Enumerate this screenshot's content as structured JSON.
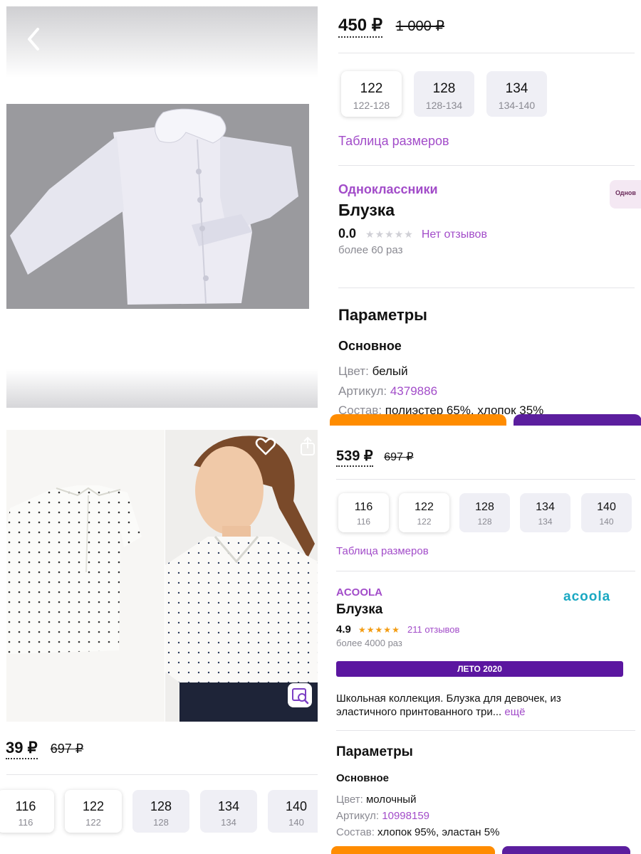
{
  "top_left": {
    "back_icon": "chevron-left-icon",
    "product_image": "white-blouse-with-peter-pan-collar"
  },
  "top_right": {
    "price": "450 ₽",
    "old_price": "1 000 ₽",
    "sizes": [
      {
        "main": "122",
        "range": "122-128",
        "selected": true
      },
      {
        "main": "128",
        "range": "128-134",
        "selected": false
      },
      {
        "main": "134",
        "range": "134-140",
        "selected": false
      }
    ],
    "size_table_link": "Таблица размеров",
    "brand": "Одноклассники",
    "brand_logo_text": "Однов",
    "title": "Блузка",
    "rating": "0.0",
    "reviews": "Нет отзывов",
    "bought": "более 60 раз",
    "params_title": "Параметры",
    "params_section": "Основное",
    "params": [
      {
        "label": "Цвет:",
        "value": "белый",
        "link": false
      },
      {
        "label": "Артикул:",
        "value": "4379886",
        "link": true
      },
      {
        "label": "Состав:",
        "value": "полиэстер 65%, хлопок 35%",
        "link": false
      }
    ]
  },
  "bottom_left": {
    "price": "39 ₽",
    "old_price": "697 ₽",
    "sizes": [
      {
        "main": "116",
        "range": "116",
        "selected": true
      },
      {
        "main": "122",
        "range": "122",
        "selected": true
      },
      {
        "main": "128",
        "range": "128",
        "selected": false
      },
      {
        "main": "134",
        "range": "134",
        "selected": false
      },
      {
        "main": "140",
        "range": "140",
        "selected": false
      }
    ]
  },
  "bottom_right": {
    "favorite_icon": "heart-icon",
    "share_icon": "share-icon",
    "image_search_icon": "image-search-icon",
    "price": "539 ₽",
    "old_price": "697 ₽",
    "sizes": [
      {
        "main": "116",
        "range": "116",
        "selected": true
      },
      {
        "main": "122",
        "range": "122",
        "selected": true
      },
      {
        "main": "128",
        "range": "128",
        "selected": false
      },
      {
        "main": "134",
        "range": "134",
        "selected": false
      },
      {
        "main": "140",
        "range": "140",
        "selected": false
      }
    ],
    "size_table_link": "Таблица размеров",
    "brand": "ACOOLA",
    "brand_logo_text": "acoola",
    "title": "Блузка",
    "rating": "4.9",
    "reviews": "211 отзывов",
    "bought": "более 4000 раз",
    "badge": "ЛЕТО 2020",
    "description": "Школьная коллекция. Блузка для девочек, из эластичного принтованного три...",
    "more_link": "ещё",
    "params_title": "Параметры",
    "params_section": "Основное",
    "params": [
      {
        "label": "Цвет:",
        "value": "молочный",
        "link": false
      },
      {
        "label": "Артикул:",
        "value": "10998159",
        "link": true
      },
      {
        "label": "Состав:",
        "value": "хлопок 95%, эластан 5%",
        "link": false
      }
    ]
  },
  "colors": {
    "accent_purple": "#a24cc9",
    "orange_button": "#ff8c00",
    "purple_button": "#5b1e9e",
    "badge_purple": "#5b16a0",
    "star_gold": "#f39c12"
  }
}
